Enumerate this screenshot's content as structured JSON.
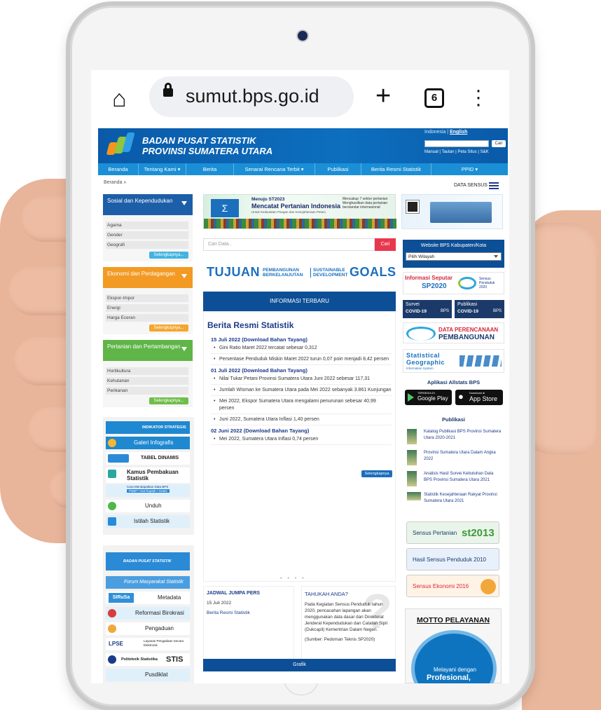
{
  "browser": {
    "url": "sumut.bps.go.id",
    "tab_count": "6"
  },
  "site": {
    "title_line1": "BADAN PUSAT STATISTIK",
    "title_line2": "PROVINSI SUMATERA UTARA",
    "lang_id": "Indonesia |",
    "lang_en": "English",
    "search_button": "Cari",
    "header_links": "Manual | Tautan | Peta Situs | S&K"
  },
  "nav": [
    "Beranda",
    "Tentang Kami ▾",
    "Berita",
    "Senarai Rencana Terbit ▾",
    "Publikasi",
    "Berita Resmi Statistik",
    "PPID ▾"
  ],
  "breadcrumb": "Beranda »",
  "data_sensus": "DATA SENSUS",
  "left": {
    "box1": {
      "title": "Sosial dan Kependudukan",
      "items": [
        "Agama",
        "Gender",
        "Geografi"
      ],
      "more": "Selengkapnya..."
    },
    "box2": {
      "title": "Ekonomi dan Perdagangan",
      "items": [
        "Ekspor-Impor",
        "Energi",
        "Harga Eceran"
      ],
      "more": "Selengkapnya..."
    },
    "box3": {
      "title": "Pertanian dan Pertambangan",
      "items": [
        "Hortikultura",
        "Kehutanan",
        "Perikanan"
      ],
      "more": "Selengkapnya..."
    },
    "tiles": [
      "INDIKATOR STRATEGIS",
      "Galeri Infografis",
      "TABEL DINAMIS",
      "Kamus Pembakuan Statistik",
      "Cara Mendapatkan Data BPS",
      "PNBP • Nol Rupiah • Gratis",
      "Unduh",
      "Istilah Statistik"
    ],
    "tiles2": [
      "BADAN PUSAT STATISTIK",
      "Forum Masyarakat Statistik",
      "SIRuSa",
      "Metadata",
      "Reformasi Birokrasi",
      "Pengaduan",
      "LPSE",
      "Layanan Pengadaan Secara Elektronik",
      "Politeknik Statistika",
      "STIS",
      "Pusdiklat"
    ]
  },
  "banner": {
    "line1": "Menuju ST2023",
    "line2": "Mencatat Pertanian Indonesia",
    "line3": "Untuk Kedaulatan Pangan dan Kesejahteraan Petani",
    "line4": "Mencakup 7 sektor pertanian Menghasilkan data pertanian berstandar internasional"
  },
  "middle": {
    "search_placeholder": "Cari Data..",
    "search_button": "Cari",
    "sdg_word1": "TUJUAN",
    "sdg_sub1": "PEMBANGUNAN BERKELANJUTAN",
    "sdg_sub2": "SUSTAINABLE DEVELOPMENT",
    "sdg_word2": "GOALS",
    "info_header": "INFORMASI TERBARU",
    "brs_title": "Berita Resmi Statistik",
    "groups": [
      {
        "date": "15 Juli 2022",
        "dl": "(Download Bahan Tayang)",
        "items": [
          "Gini Ratio Maret 2022 tercatat sebesar 0,312",
          "Persentase Penduduk Miskin Maret 2022 turun 0,07 poin menjadi 8,42 persen"
        ]
      },
      {
        "date": "01 Juli 2022",
        "dl": "(Download Bahan Tayang)",
        "items": [
          "Nilai Tukar Petani Provinsi Sumatera Utara Juni 2022 sebesar 117,31",
          "Jumlah Wisman ke Sumatera Utara pada Mei 2022 sebanyak 3.861 Kunjungan",
          "Mei 2022, Ekspor Sumatera Utara mengalami penurunan sebesar 40,99 persen",
          "Juni 2022, Sumatera Utara Inflasi 1,40 persen"
        ]
      },
      {
        "date": "02 Juni 2022",
        "dl": "(Download Bahan Tayang)",
        "items": [
          "Mei 2022, Sumatera Utara Inflasi 0,74 persen"
        ]
      }
    ],
    "more": "Selengkapnya",
    "jadwal_title": "JADWAL JUMPA PERS",
    "jadwal_date": "15 Juli 2022",
    "jadwal_link": "Berita Resmi Statistik",
    "tahu_title": "TAHUKAH ANDA?",
    "tahu_body": "Pada Kegiatan Sensus Penduduk tahun 2020, pencacahan lapangan akan menggunakan data dasar dari Direktorat Jenderal Kependudukan dan Catatan Sipil (Dukcapil) Kementrian Dalam Negeri.",
    "tahu_source": "(Sumber: Pedoman Teknis SP2020)",
    "grafik": "Grafik"
  },
  "right": {
    "wk_title": "Website BPS Kabupaten/Kota",
    "wk_select": "Pilih Wilayah",
    "sp2020_l1": "Informasi Seputar",
    "sp2020_l2": "SP2020",
    "sp2020_logo": "Sensus Penduduk 2020",
    "covid1": "Survei",
    "covid2": "Publikasi",
    "covid_sub": "COVID-19",
    "bps": "BPS",
    "dp1": "DATA PERENCANAAN",
    "dp2": "PEMBANGUNAN",
    "sg1": "Statistical",
    "sg2": "Geographic",
    "sg3": "Information System",
    "allstats": "Aplikasi Allstats BPS",
    "gplay_small": "TERSEDIA DI",
    "gplay": "Google Play",
    "appstore_small": "Download di",
    "appstore": "App Store",
    "publikasi": "Publikasi",
    "pubs": [
      "Katalog Publikasi BPS Provinsi Sumatera Utara 2020-2021",
      "Provinsi Sumatera Utara Dalam Angka 2022",
      "Analisis Hasil Survei Kebutuhan Data BPS Provinsi Sumatera Utara 2021",
      "Statistik Kesejahteraan Rakyat Provinsi Sumatera Utara 2021"
    ],
    "st2013_label": "Sensus Pertanian",
    "st2013_logo": "st2013",
    "sp2010": "Hasil Sensus Penduduk 2010",
    "se2016": "Sensus Ekonomi 2016",
    "motto": "MOTTO PELAYANAN",
    "motto_t1": "Melayani dengan",
    "motto_t2": "Profesional,"
  }
}
